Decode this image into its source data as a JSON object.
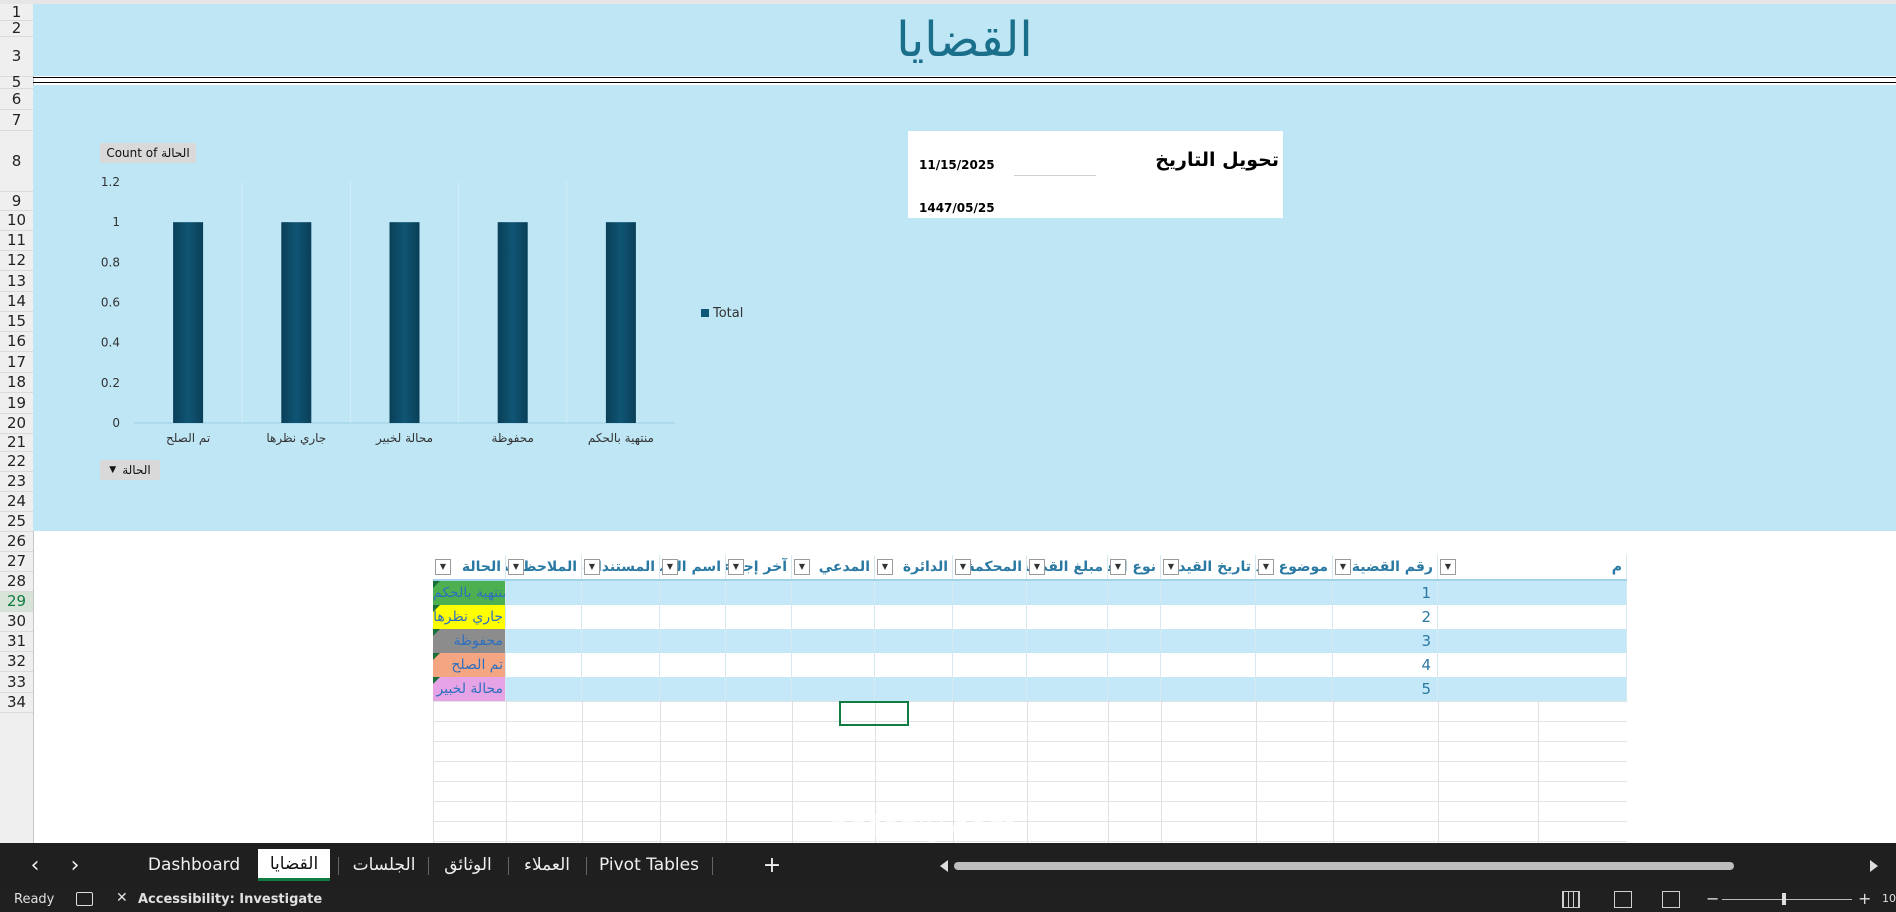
{
  "sheet": {
    "title": "القضايا",
    "row_numbers": [
      "1",
      "2",
      "3",
      "5",
      "6",
      "7",
      "8",
      "9",
      "10",
      "11",
      "12",
      "13",
      "14",
      "15",
      "16",
      "17",
      "18",
      "19",
      "20",
      "21",
      "22",
      "23",
      "24",
      "25",
      "26",
      "27",
      "28",
      "29",
      "30",
      "31",
      "32",
      "33",
      "34"
    ],
    "active_row": "29"
  },
  "date_convert": {
    "label": "تحويل التاريخ",
    "gregorian": "11/15/2025",
    "hijri": "1447/05/25"
  },
  "pivot": {
    "value_button": "Count of الحالة",
    "field_button": "الحالة",
    "dropdown_glyph": "▼"
  },
  "chart_data": {
    "type": "bar",
    "categories": [
      "تم الصلح",
      "جاري نظرها",
      "محالة لخبير",
      "محفوظة",
      "منتهية بالحكم"
    ],
    "series": [
      {
        "name": "Total",
        "values": [
          1,
          1,
          1,
          1,
          1
        ]
      }
    ],
    "ylim": [
      0,
      1.2
    ],
    "yticks": [
      "0",
      "0.2",
      "0.4",
      "0.6",
      "0.8",
      "1",
      "1.2"
    ],
    "legend": "right",
    "bar_color": "#0f5574"
  },
  "table": {
    "headers": [
      "م",
      "رقم القضية",
      "موضوع الدعوى",
      "تاريخ القيد",
      "نوع القضية",
      "مبلغ القضية",
      "المحكمة",
      "الدائرة",
      "المدعي",
      "آخر إجراء",
      "اسم العميل",
      "المستندات",
      "الملاحظات",
      "الحالة"
    ],
    "rows": [
      {
        "num": "1",
        "status": "منتهية بالحكم",
        "status_bg": "#4caf50",
        "status_fg": "#2f6fbf"
      },
      {
        "num": "2",
        "status": "جاري نظرها",
        "status_bg": "#ffff00",
        "status_fg": "#2f6fbf"
      },
      {
        "num": "3",
        "status": "محفوظة",
        "status_bg": "#8c8c8c",
        "status_fg": "#2f6fbf"
      },
      {
        "num": "4",
        "status": "تم الصلح",
        "status_bg": "#f4a582",
        "status_fg": "#2f6fbf"
      },
      {
        "num": "5",
        "status": "محالة لخبير",
        "status_bg": "#e6a3e6",
        "status_fg": "#2f6fbf"
      }
    ]
  },
  "tabs": {
    "prev": "‹",
    "next": "›",
    "items": [
      "Dashboard",
      "القضايا",
      "الجلسات",
      "الوثائق",
      "العملاء",
      "Pivot Tables"
    ],
    "active": "القضايا",
    "add": "+"
  },
  "statusbar": {
    "ready": "Ready",
    "accessibility": "Accessibility: Investigate",
    "zoom": "10"
  },
  "watermark": "nafezly.com",
  "colors": {
    "band": "#bfe6f5",
    "accent": "#107c41",
    "header_text": "#2a79a3"
  }
}
